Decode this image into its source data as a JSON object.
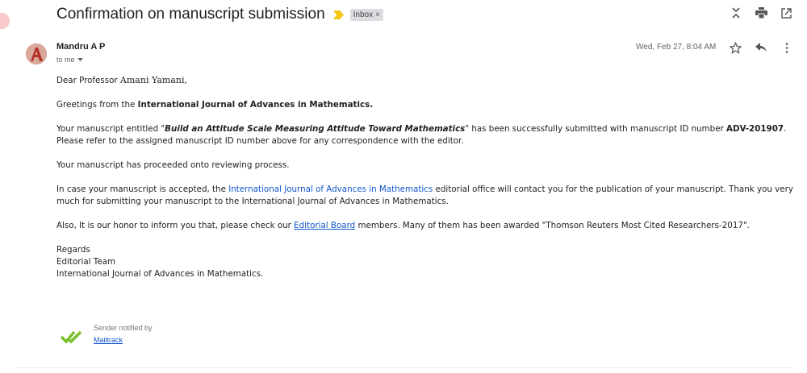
{
  "subject": "Confirmation on manuscript submission",
  "label_chip": "Inbox",
  "label_chip_close": "×",
  "sender": {
    "name": "Mandru A P",
    "to": "to me",
    "date": "Wed, Feb 27, 8:04 AM"
  },
  "body": {
    "greeting_prefix": "Dear Professor",
    "greeting_name": "Amani Yamani,",
    "p1_prefix": "Greetings from the ",
    "p1_journal": "International Journal of Advances in Mathematics.",
    "p2_a": "Your manuscript entitled \"",
    "p2_title": "Build an Attitude Scale Measuring Attitude Toward Mathematics",
    "p2_b": "\" has been successfully submitted with manuscript ID number ",
    "p2_id": "ADV-201907",
    "p2_c": ". Please refer to the assigned manuscript ID number above for any correspondence with the editor.",
    "p3": "Your manuscript has proceeded onto reviewing process.",
    "p4_a": "In case your manuscript is accepted, the ",
    "p4_link": "International Journal of Advances in Mathematics",
    "p4_b": " editorial office will contact you for the publication of your manuscript. Thank you very much for submitting your manuscript to the International Journal of Advances in Mathematics.",
    "p5_a": "Also, It is our honor to inform you that, please check our ",
    "p5_link": "Editorial Board",
    "p5_b": " members. Many of them has been awarded \"Thomson Reuters Most Cited Researchers-2017\".",
    "regards": "Regards",
    "team": "Editorial Team",
    "journal_sign": "International Journal of Advances in Mathematics."
  },
  "mailtrack": {
    "text": "Sender notified by",
    "link": "Mailtrack"
  },
  "icons": {
    "collapse": "collapse-all-icon",
    "print": "print-icon",
    "new_window": "open-new-window-icon",
    "star": "star-icon",
    "reply": "reply-icon",
    "more": "more-vert-icon",
    "importance": "importance-marker-icon",
    "check": "double-check-icon"
  },
  "colors": {
    "link": "#1155cc",
    "importance": "#f5c518",
    "check": "#7bbf2a",
    "chip_bg": "#dadce0"
  }
}
